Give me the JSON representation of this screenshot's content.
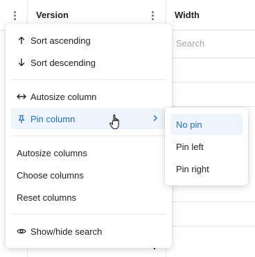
{
  "grid": {
    "columns": [
      {
        "header": "Version"
      },
      {
        "header": "Width",
        "search_placeholder": "Search"
      }
    ]
  },
  "column_menu": {
    "items": [
      {
        "label": "Sort ascending",
        "icon": "arrow-up-icon",
        "glyph": "↑"
      },
      {
        "label": "Sort descending",
        "icon": "arrow-down-icon",
        "glyph": "↓"
      },
      {
        "label": "Autosize column",
        "icon": "horizontal-resize-icon",
        "glyph": "↔"
      },
      {
        "label": "Pin column",
        "icon": "pin-icon",
        "active": true,
        "has_submenu": true
      },
      {
        "label": "Autosize columns"
      },
      {
        "label": "Choose columns"
      },
      {
        "label": "Reset columns"
      },
      {
        "label": "Show/hide search",
        "icon": "eye-icon"
      }
    ]
  },
  "pin_submenu": {
    "items": [
      {
        "label": "No pin",
        "selected": true
      },
      {
        "label": "Pin left"
      },
      {
        "label": "Pin right"
      }
    ]
  },
  "colors": {
    "accent": "#1f6fd1",
    "active_bg": "#eef4fc",
    "border": "#e3e6ea",
    "text": "#222222",
    "placeholder": "#a3a8b0"
  }
}
